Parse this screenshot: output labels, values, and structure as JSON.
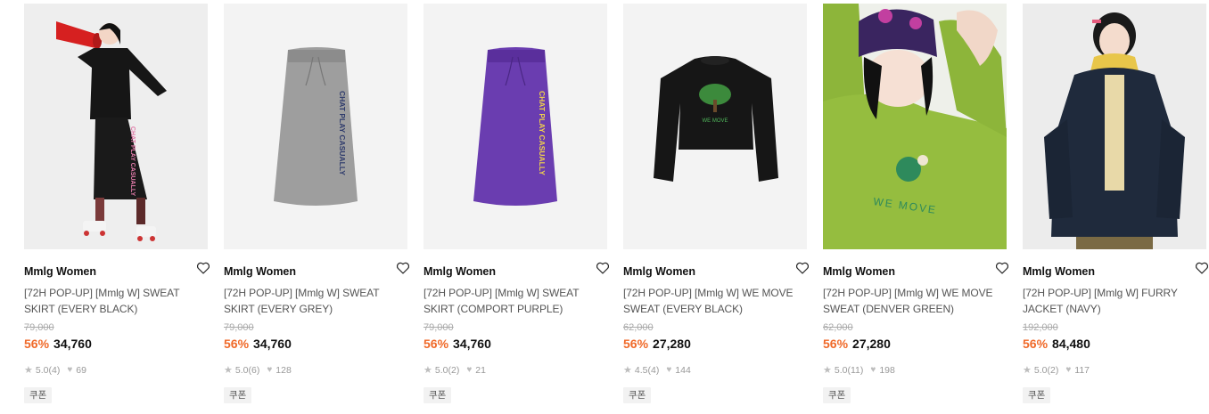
{
  "products": [
    {
      "brand": "Mmlg Women",
      "name": "[72H POP-UP] [Mmlg W] SWEAT SKIRT (EVERY BLACK)",
      "original_price": "79,000",
      "discount": "56%",
      "price": "34,760",
      "rating": "5.0",
      "review_count": "(4)",
      "likes": "69",
      "coupon": "쿠폰",
      "image": "model-black-skirt-megaphone",
      "print_text": "CHAT PLAY CASUALLY"
    },
    {
      "brand": "Mmlg Women",
      "name": "[72H POP-UP] [Mmlg W] SWEAT SKIRT (EVERY GREY)",
      "original_price": "79,000",
      "discount": "56%",
      "price": "34,760",
      "rating": "5.0",
      "review_count": "(6)",
      "likes": "128",
      "coupon": "쿠폰",
      "image": "grey-skirt-flat",
      "print_text": "CHAT PLAY CASUALLY"
    },
    {
      "brand": "Mmlg Women",
      "name": "[72H POP-UP] [Mmlg W] SWEAT SKIRT (COMPORT PURPLE)",
      "original_price": "79,000",
      "discount": "56%",
      "price": "34,760",
      "rating": "5.0",
      "review_count": "(2)",
      "likes": "21",
      "coupon": "쿠폰",
      "image": "purple-skirt-flat",
      "print_text": "CHAT PLAY CASUALLY"
    },
    {
      "brand": "Mmlg Women",
      "name": "[72H POP-UP] [Mmlg W] WE MOVE SWEAT (EVERY BLACK)",
      "original_price": "62,000",
      "discount": "56%",
      "price": "27,280",
      "rating": "4.5",
      "review_count": "(4)",
      "likes": "144",
      "coupon": "쿠폰",
      "image": "black-sweat-flat",
      "print_text": "WE MOVE"
    },
    {
      "brand": "Mmlg Women",
      "name": "[72H POP-UP] [Mmlg W] WE MOVE SWEAT (DENVER GREEN)",
      "original_price": "62,000",
      "discount": "56%",
      "price": "27,280",
      "rating": "5.0",
      "review_count": "(11)",
      "likes": "198",
      "coupon": "쿠폰",
      "image": "model-green-sweat",
      "print_text": "WE MOVE"
    },
    {
      "brand": "Mmlg Women",
      "name": "[72H POP-UP] [Mmlg W] FURRY JACKET (NAVY)",
      "original_price": "192,000",
      "discount": "56%",
      "price": "84,480",
      "rating": "5.0",
      "review_count": "(2)",
      "likes": "117",
      "coupon": "쿠폰",
      "image": "model-navy-furry-jacket"
    }
  ],
  "colors": {
    "discount": "#f06a2a",
    "brand_text": "#111111",
    "name_text": "#555555",
    "meta_text": "#999999",
    "coupon_bg": "#f2f2f2"
  },
  "icons": {
    "wishlist": "heart-outline-icon",
    "rating": "star-icon",
    "likes": "heart-filled-icon"
  }
}
